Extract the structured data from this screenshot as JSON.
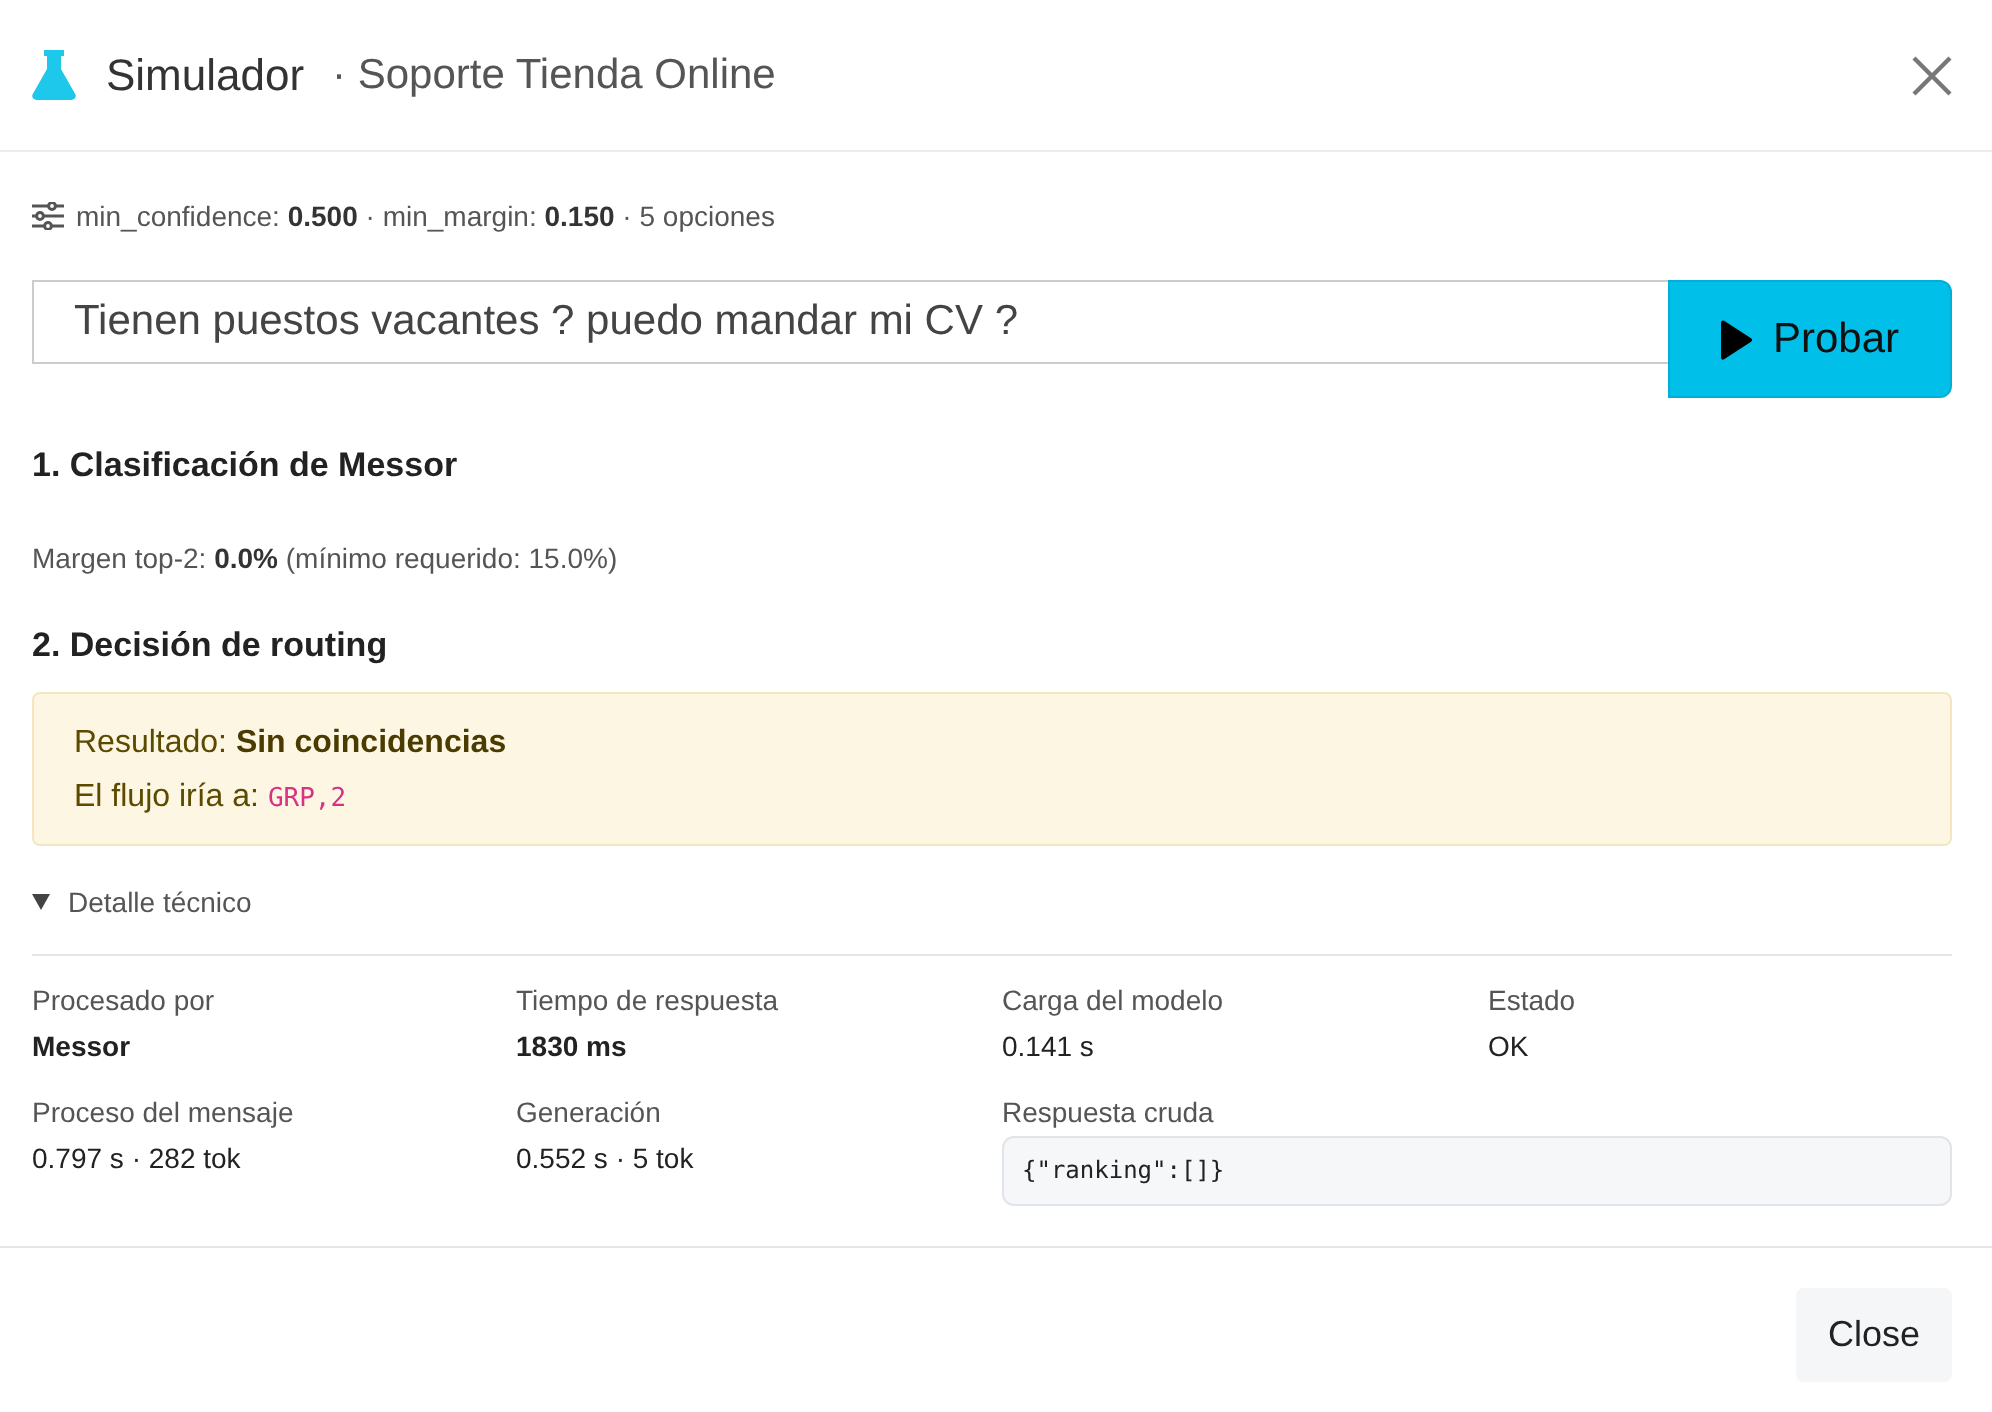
{
  "header": {
    "title": "Simulador",
    "subtitle": "· Soporte Tienda Online"
  },
  "params_line": "min_confidence: **0.500** · min_margin: **0.150** · 5 opciones",
  "query": {
    "value": "Tienen puestos vacantes ? puedo mandar mi CV ?"
  },
  "run_button": "Probar",
  "classification": {
    "title": "1. Clasificación de Messor",
    "text": "Margen top-2: **0.0%** (mínimo requerido: 15.0%)"
  },
  "routing": {
    "title": "2. Decisión de routing",
    "result": "Resultado: **Sin coincidencias**",
    "flow_label": "El flujo iría a:",
    "flow_target": "GRP,2"
  },
  "details": {
    "summary": "Detalle técnico",
    "expanded": true,
    "fields": [
      {
        "label": "Procesado por",
        "value": "Messor",
        "kind": "strong"
      },
      {
        "label": "Tiempo de respuesta",
        "value": "1830 ms",
        "kind": "strong"
      },
      {
        "label": "Carga del modelo",
        "value": "0.141 s",
        "kind": "plain"
      },
      {
        "label": "Estado",
        "value": "OK",
        "kind": "plain"
      },
      {
        "label": "Proceso del mensaje",
        "value": "0.797 s · 282 tok",
        "kind": "plain"
      },
      {
        "label": "Generación",
        "value": "0.552 s · 5 tok",
        "kind": "plain"
      },
      {
        "label": "Respuesta cruda",
        "value": "{\"ranking\":[]}",
        "kind": "code"
      }
    ]
  },
  "footer": {
    "close_button": "Close"
  }
}
